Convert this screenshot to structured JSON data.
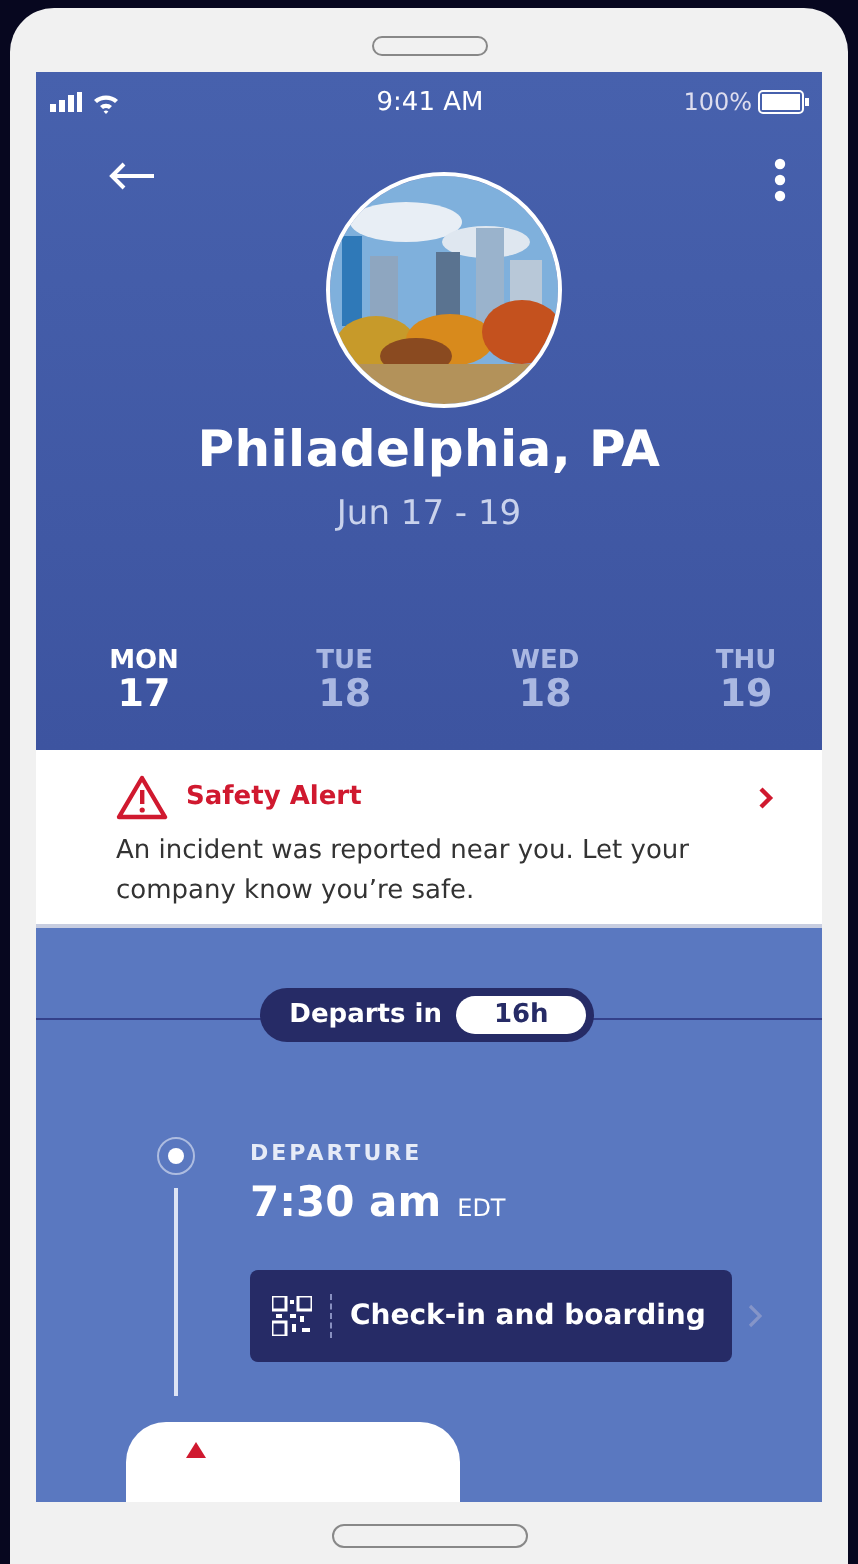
{
  "status_bar": {
    "time": "9:41 AM",
    "battery": "100%"
  },
  "trip": {
    "city": "Philadelphia, PA",
    "dates": "Jun 17 - 19"
  },
  "days": [
    {
      "weekday": "MON",
      "day": "17",
      "selected": true
    },
    {
      "weekday": "TUE",
      "day": "18",
      "selected": false
    },
    {
      "weekday": "WED",
      "day": "18",
      "selected": false
    },
    {
      "weekday": "THU",
      "day": "19",
      "selected": false
    }
  ],
  "alert": {
    "title": "Safety Alert",
    "message": "An incident was reported near you. Let your company know you’re safe."
  },
  "countdown": {
    "label": "Departs in",
    "value": "16h"
  },
  "departure": {
    "label": "DEPARTURE",
    "time": "7:30 am",
    "zone": "EDT"
  },
  "action": {
    "label": "Check-in and boarding"
  }
}
